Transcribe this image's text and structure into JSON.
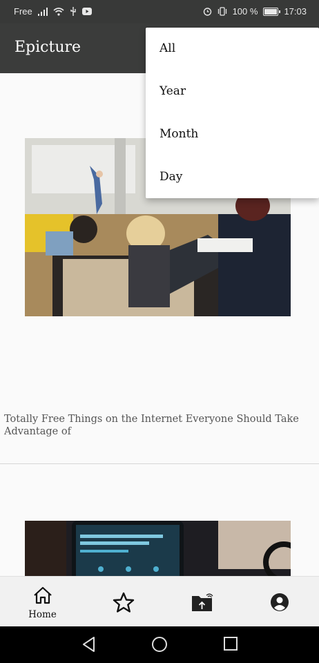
{
  "status_bar": {
    "carrier": "Free",
    "battery": "100 %",
    "time": "17:03"
  },
  "app_bar": {
    "title": "Epicture"
  },
  "menu": {
    "items": [
      "All",
      "Year",
      "Month",
      "Day"
    ]
  },
  "feed": {
    "posts": [
      {
        "title": "Totally Free Things on the Internet Everyone Should Take Advantage of"
      }
    ]
  },
  "bottom_nav": {
    "items": [
      {
        "label": "Home",
        "icon": "home-icon"
      },
      {
        "label": "",
        "icon": "star-icon"
      },
      {
        "label": "",
        "icon": "upload-folder-icon"
      },
      {
        "label": "",
        "icon": "account-icon"
      }
    ]
  },
  "system_nav": {
    "icons": [
      "back-icon",
      "home-circle-icon",
      "recents-icon"
    ]
  }
}
